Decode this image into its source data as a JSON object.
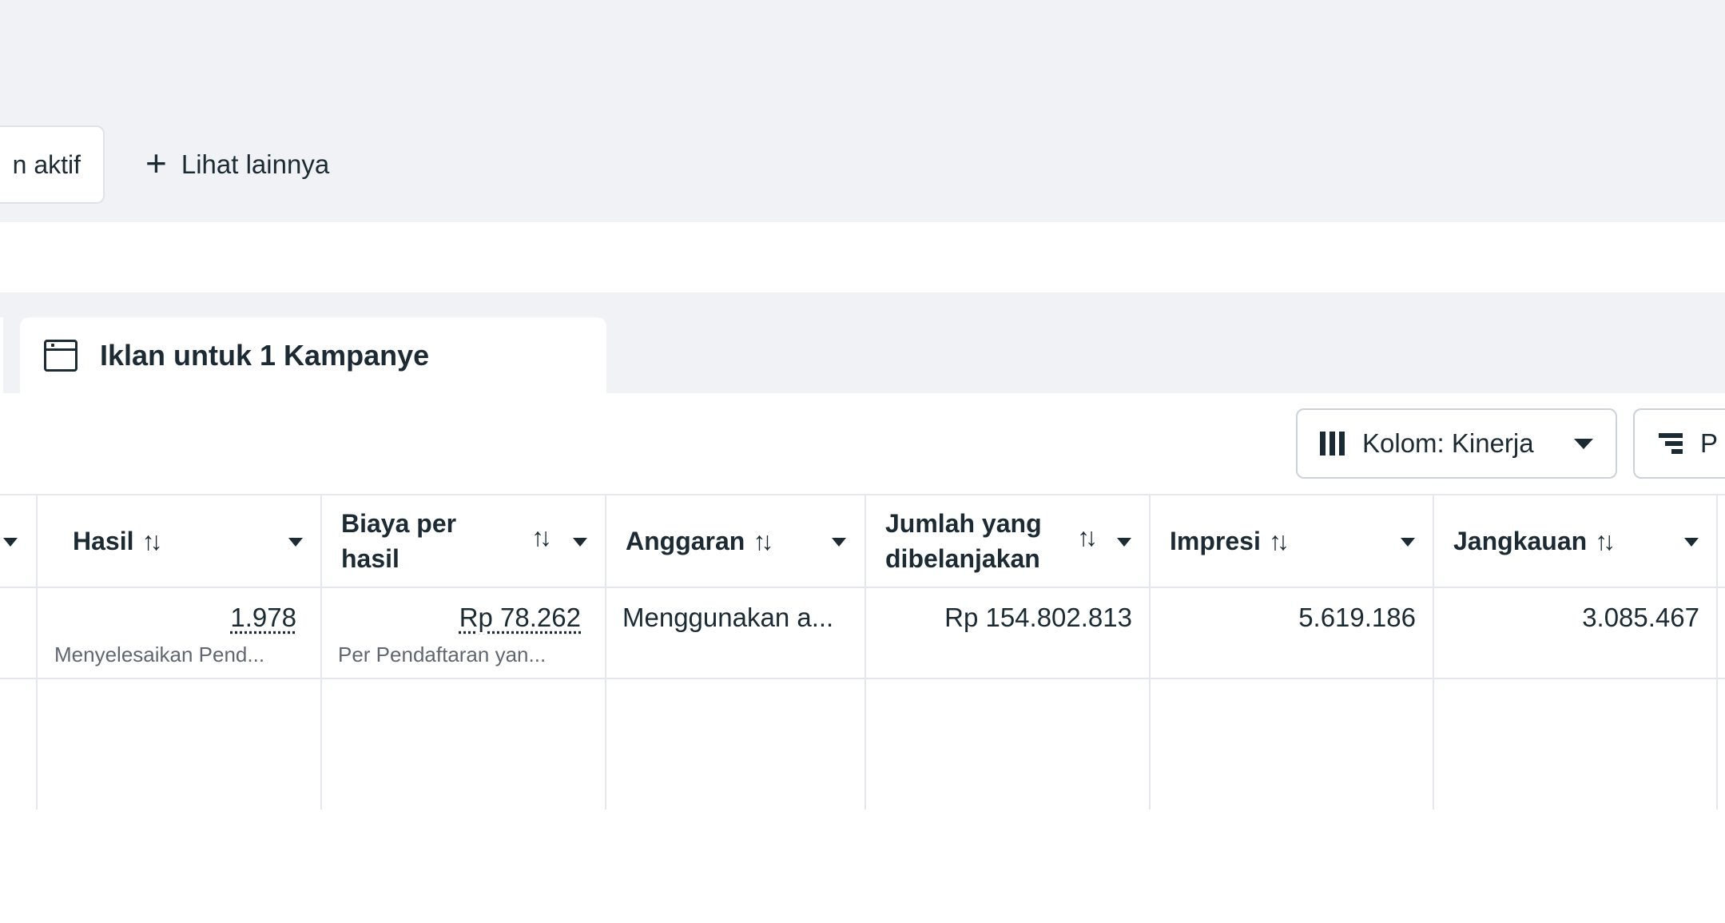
{
  "filters": {
    "active_chip_label": "n aktif",
    "see_more_label": "Lihat lainnya"
  },
  "tab": {
    "label": "Iklan untuk 1 Kampanye"
  },
  "toolbar": {
    "columns_label": "Kolom: Kinerja",
    "breakdown_label": "P"
  },
  "table": {
    "headers": {
      "results": "Hasil",
      "cost_per_result": "Biaya per hasil",
      "budget": "Anggaran",
      "amount_spent": "Jumlah yang dibelanjakan",
      "impressions": "Impresi",
      "reach": "Jangkauan"
    },
    "sort_glyph": "↑↓",
    "row": {
      "results": "1.978",
      "results_sub": "Menyelesaikan Pend...",
      "cost_per_result": "Rp 78.262",
      "cost_per_result_sub": "Per Pendaftaran yan...",
      "budget": "Menggunakan a...",
      "amount_spent": "Rp 154.802.813",
      "impressions": "5.619.186",
      "reach": "3.085.467"
    }
  }
}
